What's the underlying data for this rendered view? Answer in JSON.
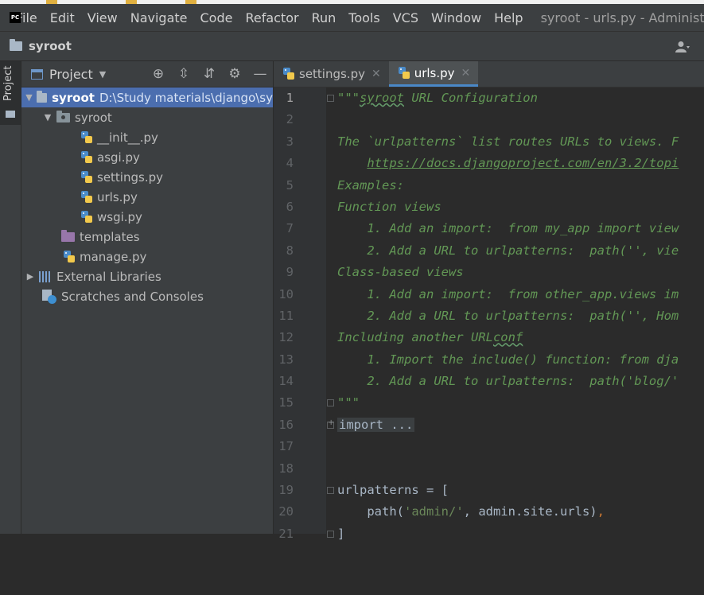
{
  "menubar": {
    "items": [
      "File",
      "Edit",
      "View",
      "Navigate",
      "Code",
      "Refactor",
      "Run",
      "Tools",
      "VCS",
      "Window",
      "Help"
    ],
    "window_title": "syroot - urls.py - Administra"
  },
  "navbar": {
    "project_name": "syroot"
  },
  "left_strip": {
    "tab_label": "Project"
  },
  "project_panel": {
    "title": "Project",
    "tree": {
      "root_name": "syroot",
      "root_path": "D:\\Study materials\\django\\sy",
      "package_name": "syroot",
      "files": [
        "__init__.py",
        "asgi.py",
        "settings.py",
        "urls.py",
        "wsgi.py"
      ],
      "templates": "templates",
      "manage": "manage.py",
      "external_libraries": "External Libraries",
      "scratches": "Scratches and Consoles"
    }
  },
  "editor": {
    "tabs": [
      "settings.py",
      "urls.py"
    ],
    "active_tab": "urls.py",
    "code": {
      "l1_quote": "\"\"\"",
      "l1_word": "syroot",
      "l1_rest": " URL Configuration",
      "l3": "The `urlpatterns` list routes URLs to views. F",
      "l4_indent": "    ",
      "l4_link": "https://docs.djangoproject.com/en/3.2/topi",
      "l5": "Examples:",
      "l6": "Function views",
      "l7": "    1. Add an import:  from my_app import view",
      "l8": "    2. Add a URL to urlpatterns:  path('', vie",
      "l9": "Class-based views",
      "l10": "    1. Add an import:  from other_app.views im",
      "l11": "    2. Add a URL to urlpatterns:  path('', Hom",
      "l12_pre": "Including another URL",
      "l12_word": "conf",
      "l13": "    1. Import the include() function: from dja",
      "l14": "    2. Add a URL to urlpatterns:  path('blog/'",
      "l15": "\"\"\"",
      "l16": "import ...",
      "l19": "urlpatterns = [",
      "l20_a": "    path(",
      "l20_str": "'admin/'",
      "l20_b": ", admin.site.urls)",
      "l20_comma": ",",
      "l21": "]"
    },
    "line_numbers": [
      "1",
      "2",
      "3",
      "4",
      "5",
      "6",
      "7",
      "8",
      "9",
      "10",
      "11",
      "12",
      "13",
      "14",
      "15",
      "16",
      "17",
      "18",
      "19",
      "20",
      "21",
      ""
    ]
  }
}
